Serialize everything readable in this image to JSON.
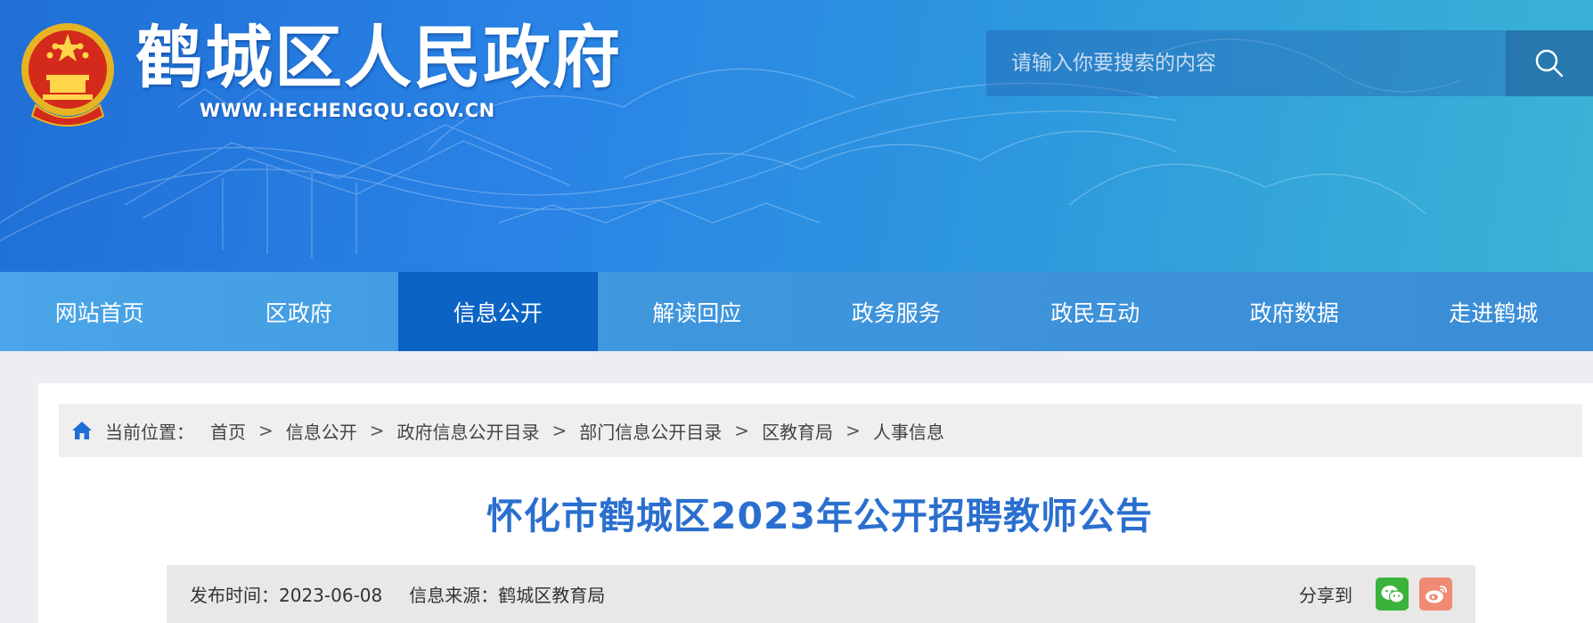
{
  "header": {
    "site_title": "鹤城区人民政府",
    "site_url": "WWW.HECHENGQU.GOV.CN",
    "emblem_icon": "national-emblem-icon"
  },
  "search": {
    "placeholder": "请输入你要搜索的内容",
    "icon": "search-icon"
  },
  "nav": {
    "items": [
      {
        "label": "网站首页"
      },
      {
        "label": "区政府"
      },
      {
        "label": "信息公开",
        "active": true
      },
      {
        "label": "解读回应"
      },
      {
        "label": "政务服务"
      },
      {
        "label": "政民互动"
      },
      {
        "label": "政府数据"
      },
      {
        "label": "走进鹤城"
      }
    ]
  },
  "breadcrumb": {
    "prefix": "当前位置：",
    "separator": ">",
    "items": [
      "首页",
      "信息公开",
      "政府信息公开目录",
      "部门信息公开目录",
      "区教育局",
      "人事信息"
    ]
  },
  "article": {
    "title": "怀化市鹤城区2023年公开招聘教师公告",
    "publish_time_label": "发布时间：",
    "publish_time": "2023-06-08",
    "source_label": "信息来源：",
    "source": "鹤城区教育局",
    "share_label": "分享到"
  },
  "colors": {
    "accent": "#0b63c4",
    "title": "#2a6fcf",
    "wechat": "#3bb33b",
    "weibo": "#f08a73"
  }
}
